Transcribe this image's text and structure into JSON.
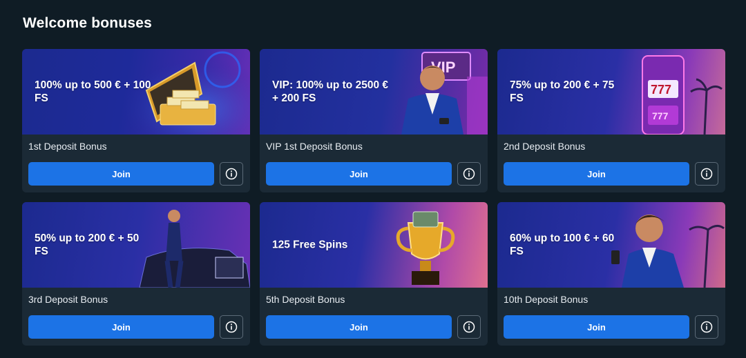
{
  "page": {
    "title": "Welcome bonuses"
  },
  "colors": {
    "background": "#0f1c25",
    "card": "#1b2a36",
    "accent": "#1c73e6",
    "banner": "#1e2a9a"
  },
  "cards": [
    {
      "headline": "100% up to 500 € + 100 FS",
      "name": "1st Deposit Bonus",
      "button": "Join",
      "image": "gold-briefcase"
    },
    {
      "headline": "VIP: 100% up to 2500 € + 200 FS",
      "name": "VIP 1st Deposit Bonus",
      "button": "Join",
      "image": "vip-man-with-phone"
    },
    {
      "headline": "75% up to 200 € + 75 FS",
      "name": "2nd Deposit Bonus",
      "button": "Join",
      "image": "slot-machine-777"
    },
    {
      "headline": "50% up to 200 € + 50 FS",
      "name": "3rd Deposit Bonus",
      "button": "Join",
      "image": "man-with-luxury-car"
    },
    {
      "headline": "125 Free Spins",
      "name": "5th Deposit Bonus",
      "button": "Join",
      "image": "trophy-with-cash"
    },
    {
      "headline": "60% up to 100 € + 60 FS",
      "name": "10th Deposit Bonus",
      "button": "Join",
      "image": "man-with-phone"
    }
  ]
}
